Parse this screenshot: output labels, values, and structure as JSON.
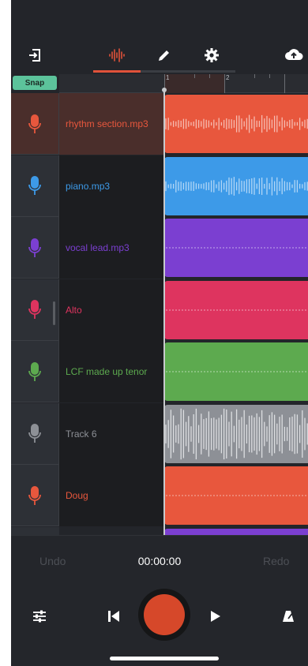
{
  "toolbar": {
    "icons": [
      "exit-icon",
      "waveform-icon",
      "pencil-icon",
      "gear-icon",
      "cloud-upload-icon"
    ],
    "active_tab": "waveform",
    "accent": "#e0523a"
  },
  "snap": {
    "label": "Snap"
  },
  "ruler": {
    "marks": [
      "1",
      "2"
    ]
  },
  "tracks": [
    {
      "name": "rhythm section.mp3",
      "color": "#e8573d",
      "waveform": "audio",
      "selected": true
    },
    {
      "name": "piano.mp3",
      "color": "#3d9ae8",
      "waveform": "audio",
      "selected": false
    },
    {
      "name": "vocal lead.mp3",
      "color": "#7b3fd1",
      "waveform": "flat",
      "selected": false
    },
    {
      "name": "Alto",
      "color": "#de345f",
      "waveform": "flat",
      "selected": false
    },
    {
      "name": "LCF made up tenor",
      "color": "#5daa4f",
      "waveform": "flat",
      "selected": false
    },
    {
      "name": "Track 6",
      "color": "#8d9096",
      "waveform": "loud",
      "selected": false
    },
    {
      "name": "Doug",
      "color": "#e8573d",
      "waveform": "flat",
      "selected": false
    }
  ],
  "transport": {
    "undo_label": "Undo",
    "redo_label": "Redo",
    "time": "00:00:00",
    "icons": [
      "mixer-icon",
      "skip-back-icon",
      "record-icon",
      "play-icon",
      "metronome-icon"
    ]
  }
}
